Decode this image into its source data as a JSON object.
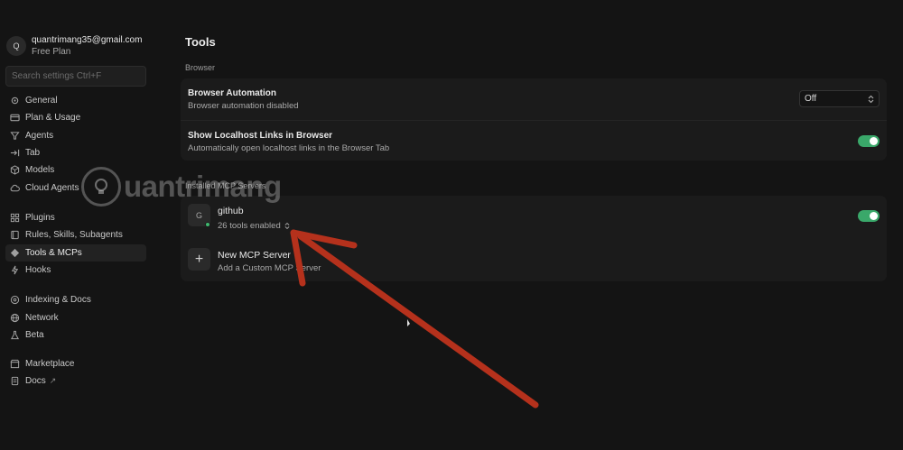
{
  "account": {
    "avatar_letter": "Q",
    "email": "quantrimang35@gmail.com",
    "plan": "Free Plan"
  },
  "search": {
    "placeholder": "Search settings Ctrl+F"
  },
  "sidebar": {
    "items": [
      {
        "label": "General",
        "icon": "gear-icon"
      },
      {
        "label": "Plan & Usage",
        "icon": "card-icon"
      },
      {
        "label": "Agents",
        "icon": "agents-icon"
      },
      {
        "label": "Tab",
        "icon": "tab-arrow-icon"
      },
      {
        "label": "Models",
        "icon": "cube-icon"
      },
      {
        "label": "Cloud Agents",
        "icon": "cloud-icon"
      },
      {
        "label": "Plugins",
        "icon": "grid-icon"
      },
      {
        "label": "Rules, Skills, Subagents",
        "icon": "book-icon"
      },
      {
        "label": "Tools & MCPs",
        "icon": "diamond-icon",
        "active": true
      },
      {
        "label": "Hooks",
        "icon": "hook-icon"
      },
      {
        "label": "Indexing & Docs",
        "icon": "database-icon"
      },
      {
        "label": "Network",
        "icon": "globe-icon"
      },
      {
        "label": "Beta",
        "icon": "flask-icon"
      },
      {
        "label": "Marketplace",
        "icon": "store-icon"
      },
      {
        "label": "Docs",
        "icon": "doc-icon",
        "external": "↗"
      }
    ]
  },
  "main": {
    "title": "Tools",
    "browser_section": "Browser",
    "browser_automation": {
      "title": "Browser Automation",
      "subtitle": "Browser automation disabled",
      "select_value": "Off"
    },
    "localhost_links": {
      "title": "Show Localhost Links in Browser",
      "subtitle": "Automatically open localhost links in the Browser Tab",
      "enabled": true
    },
    "mcp_section": "Installed MCP Servers",
    "servers": [
      {
        "icon_letter": "G",
        "name": "github",
        "status": "26 tools enabled",
        "enabled": true,
        "status_color": "#3fb86e"
      }
    ],
    "new_server": {
      "title": "New MCP Server",
      "subtitle": "Add a Custom MCP Server"
    }
  },
  "watermark": {
    "text": "uantrimang"
  },
  "colors": {
    "toggle_on": "#3aa86a",
    "annotation_arrow": "#b5311c",
    "background": "#141414"
  }
}
